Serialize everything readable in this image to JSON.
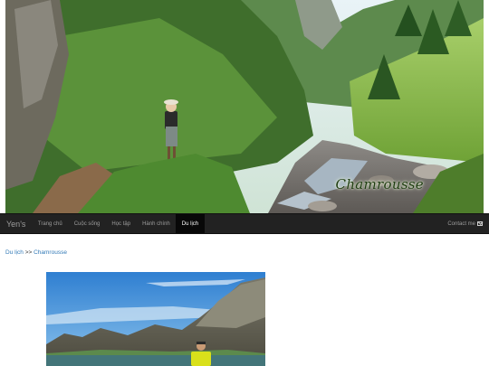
{
  "hero": {
    "caption": "Chamrousse"
  },
  "navbar": {
    "brand": "Yen's",
    "items": [
      {
        "label": "Trang chủ",
        "active": false
      },
      {
        "label": "Cuộc sống",
        "active": false
      },
      {
        "label": "Học tập",
        "active": false
      },
      {
        "label": "Hành chính",
        "active": false
      },
      {
        "label": "Du lịch",
        "active": true
      }
    ],
    "contact_label": "Contact me",
    "contact_icon": "envelope-icon"
  },
  "breadcrumb": {
    "parent": "Du lịch",
    "separator": ">>",
    "current": "Chamrousse"
  },
  "colors": {
    "navbar_bg": "#222222",
    "nav_active_bg": "#080808",
    "link": "#337ab7"
  }
}
